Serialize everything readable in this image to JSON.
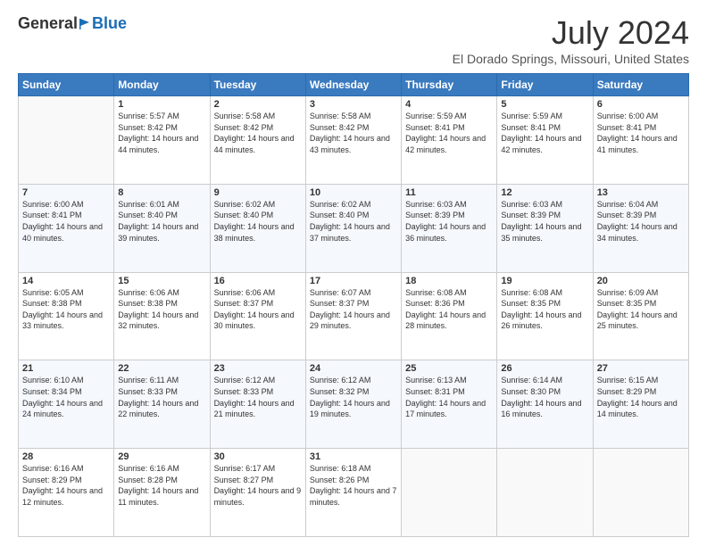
{
  "logo": {
    "general": "General",
    "blue": "Blue"
  },
  "header": {
    "month": "July 2024",
    "location": "El Dorado Springs, Missouri, United States"
  },
  "weekdays": [
    "Sunday",
    "Monday",
    "Tuesday",
    "Wednesday",
    "Thursday",
    "Friday",
    "Saturday"
  ],
  "weeks": [
    [
      {
        "day": "",
        "sunrise": "",
        "sunset": "",
        "daylight": ""
      },
      {
        "day": "1",
        "sunrise": "Sunrise: 5:57 AM",
        "sunset": "Sunset: 8:42 PM",
        "daylight": "Daylight: 14 hours and 44 minutes."
      },
      {
        "day": "2",
        "sunrise": "Sunrise: 5:58 AM",
        "sunset": "Sunset: 8:42 PM",
        "daylight": "Daylight: 14 hours and 44 minutes."
      },
      {
        "day": "3",
        "sunrise": "Sunrise: 5:58 AM",
        "sunset": "Sunset: 8:42 PM",
        "daylight": "Daylight: 14 hours and 43 minutes."
      },
      {
        "day": "4",
        "sunrise": "Sunrise: 5:59 AM",
        "sunset": "Sunset: 8:41 PM",
        "daylight": "Daylight: 14 hours and 42 minutes."
      },
      {
        "day": "5",
        "sunrise": "Sunrise: 5:59 AM",
        "sunset": "Sunset: 8:41 PM",
        "daylight": "Daylight: 14 hours and 42 minutes."
      },
      {
        "day": "6",
        "sunrise": "Sunrise: 6:00 AM",
        "sunset": "Sunset: 8:41 PM",
        "daylight": "Daylight: 14 hours and 41 minutes."
      }
    ],
    [
      {
        "day": "7",
        "sunrise": "Sunrise: 6:00 AM",
        "sunset": "Sunset: 8:41 PM",
        "daylight": "Daylight: 14 hours and 40 minutes."
      },
      {
        "day": "8",
        "sunrise": "Sunrise: 6:01 AM",
        "sunset": "Sunset: 8:40 PM",
        "daylight": "Daylight: 14 hours and 39 minutes."
      },
      {
        "day": "9",
        "sunrise": "Sunrise: 6:02 AM",
        "sunset": "Sunset: 8:40 PM",
        "daylight": "Daylight: 14 hours and 38 minutes."
      },
      {
        "day": "10",
        "sunrise": "Sunrise: 6:02 AM",
        "sunset": "Sunset: 8:40 PM",
        "daylight": "Daylight: 14 hours and 37 minutes."
      },
      {
        "day": "11",
        "sunrise": "Sunrise: 6:03 AM",
        "sunset": "Sunset: 8:39 PM",
        "daylight": "Daylight: 14 hours and 36 minutes."
      },
      {
        "day": "12",
        "sunrise": "Sunrise: 6:03 AM",
        "sunset": "Sunset: 8:39 PM",
        "daylight": "Daylight: 14 hours and 35 minutes."
      },
      {
        "day": "13",
        "sunrise": "Sunrise: 6:04 AM",
        "sunset": "Sunset: 8:39 PM",
        "daylight": "Daylight: 14 hours and 34 minutes."
      }
    ],
    [
      {
        "day": "14",
        "sunrise": "Sunrise: 6:05 AM",
        "sunset": "Sunset: 8:38 PM",
        "daylight": "Daylight: 14 hours and 33 minutes."
      },
      {
        "day": "15",
        "sunrise": "Sunrise: 6:06 AM",
        "sunset": "Sunset: 8:38 PM",
        "daylight": "Daylight: 14 hours and 32 minutes."
      },
      {
        "day": "16",
        "sunrise": "Sunrise: 6:06 AM",
        "sunset": "Sunset: 8:37 PM",
        "daylight": "Daylight: 14 hours and 30 minutes."
      },
      {
        "day": "17",
        "sunrise": "Sunrise: 6:07 AM",
        "sunset": "Sunset: 8:37 PM",
        "daylight": "Daylight: 14 hours and 29 minutes."
      },
      {
        "day": "18",
        "sunrise": "Sunrise: 6:08 AM",
        "sunset": "Sunset: 8:36 PM",
        "daylight": "Daylight: 14 hours and 28 minutes."
      },
      {
        "day": "19",
        "sunrise": "Sunrise: 6:08 AM",
        "sunset": "Sunset: 8:35 PM",
        "daylight": "Daylight: 14 hours and 26 minutes."
      },
      {
        "day": "20",
        "sunrise": "Sunrise: 6:09 AM",
        "sunset": "Sunset: 8:35 PM",
        "daylight": "Daylight: 14 hours and 25 minutes."
      }
    ],
    [
      {
        "day": "21",
        "sunrise": "Sunrise: 6:10 AM",
        "sunset": "Sunset: 8:34 PM",
        "daylight": "Daylight: 14 hours and 24 minutes."
      },
      {
        "day": "22",
        "sunrise": "Sunrise: 6:11 AM",
        "sunset": "Sunset: 8:33 PM",
        "daylight": "Daylight: 14 hours and 22 minutes."
      },
      {
        "day": "23",
        "sunrise": "Sunrise: 6:12 AM",
        "sunset": "Sunset: 8:33 PM",
        "daylight": "Daylight: 14 hours and 21 minutes."
      },
      {
        "day": "24",
        "sunrise": "Sunrise: 6:12 AM",
        "sunset": "Sunset: 8:32 PM",
        "daylight": "Daylight: 14 hours and 19 minutes."
      },
      {
        "day": "25",
        "sunrise": "Sunrise: 6:13 AM",
        "sunset": "Sunset: 8:31 PM",
        "daylight": "Daylight: 14 hours and 17 minutes."
      },
      {
        "day": "26",
        "sunrise": "Sunrise: 6:14 AM",
        "sunset": "Sunset: 8:30 PM",
        "daylight": "Daylight: 14 hours and 16 minutes."
      },
      {
        "day": "27",
        "sunrise": "Sunrise: 6:15 AM",
        "sunset": "Sunset: 8:29 PM",
        "daylight": "Daylight: 14 hours and 14 minutes."
      }
    ],
    [
      {
        "day": "28",
        "sunrise": "Sunrise: 6:16 AM",
        "sunset": "Sunset: 8:29 PM",
        "daylight": "Daylight: 14 hours and 12 minutes."
      },
      {
        "day": "29",
        "sunrise": "Sunrise: 6:16 AM",
        "sunset": "Sunset: 8:28 PM",
        "daylight": "Daylight: 14 hours and 11 minutes."
      },
      {
        "day": "30",
        "sunrise": "Sunrise: 6:17 AM",
        "sunset": "Sunset: 8:27 PM",
        "daylight": "Daylight: 14 hours and 9 minutes."
      },
      {
        "day": "31",
        "sunrise": "Sunrise: 6:18 AM",
        "sunset": "Sunset: 8:26 PM",
        "daylight": "Daylight: 14 hours and 7 minutes."
      },
      {
        "day": "",
        "sunrise": "",
        "sunset": "",
        "daylight": ""
      },
      {
        "day": "",
        "sunrise": "",
        "sunset": "",
        "daylight": ""
      },
      {
        "day": "",
        "sunrise": "",
        "sunset": "",
        "daylight": ""
      }
    ]
  ]
}
